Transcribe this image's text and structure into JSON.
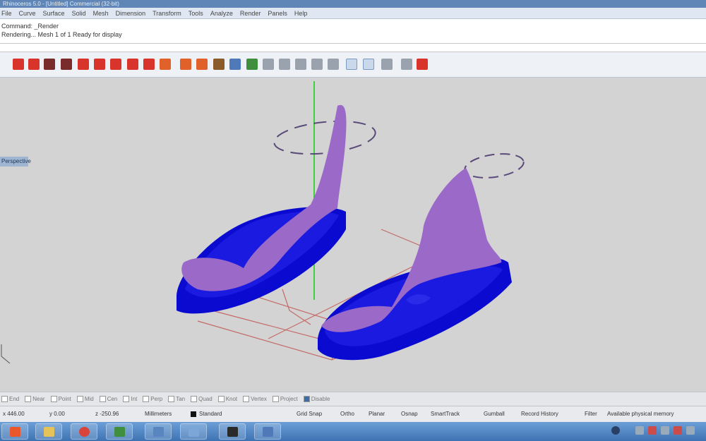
{
  "window": {
    "title": "Rhinoceros 5.0 - [Untitled] Commercial (32-bit)"
  },
  "menu": [
    "File",
    "Curve",
    "Surface",
    "Solid",
    "Mesh",
    "Dimension",
    "Transform",
    "Tools",
    "Analyze",
    "Render",
    "Panels",
    "Help"
  ],
  "command": {
    "history_line1": "Command: _Render",
    "history_line2": "Rendering... Mesh 1 of 1 Ready for display",
    "prompt_value": ""
  },
  "viewport": {
    "tab_label": "Perspective"
  },
  "osnap": [
    {
      "label": "End",
      "checked": false
    },
    {
      "label": "Near",
      "checked": false
    },
    {
      "label": "Point",
      "checked": false
    },
    {
      "label": "Mid",
      "checked": false
    },
    {
      "label": "Cen",
      "checked": false
    },
    {
      "label": "Int",
      "checked": false
    },
    {
      "label": "Perp",
      "checked": false
    },
    {
      "label": "Tan",
      "checked": false
    },
    {
      "label": "Quad",
      "checked": false
    },
    {
      "label": "Knot",
      "checked": false
    },
    {
      "label": "Vertex",
      "checked": false
    },
    {
      "label": "Project",
      "checked": false
    },
    {
      "label": "Disable",
      "checked": true
    }
  ],
  "status": {
    "x": "x 446.00",
    "y": "y 0.00",
    "z": "z -250.96",
    "units": "Millimeters",
    "layer": "Standard",
    "grid_snap": "Grid Snap",
    "ortho": "Ortho",
    "planar": "Planar",
    "osnap": "Osnap",
    "smarttrack": "SmartTrack",
    "gumball": "Gumball",
    "record_history": "Record History",
    "filter": "Filter",
    "memory": "Available physical memory"
  },
  "colors": {
    "accent": "#3c6ea5",
    "mesh_blue": "#0a0ad0",
    "foot_purple": "#9b6ac8",
    "axis_green": "#3fd13f",
    "axis_red": "#c0504d"
  },
  "icons": {
    "toolbar": [
      "red",
      "red",
      "dark",
      "dark",
      "red",
      "red",
      "red",
      "red",
      "red",
      "orange",
      "orange",
      "brown",
      "blue",
      "green",
      "gray",
      "gray",
      "gray",
      "gray",
      "gray",
      "sel",
      "sel",
      "gray",
      "gray",
      "red"
    ],
    "taskbar": [
      "windows-start-icon",
      "folder-icon",
      "chrome-icon",
      "app-icon",
      "app-icon",
      "app-icon",
      "rhino-icon",
      "window-icon"
    ]
  }
}
